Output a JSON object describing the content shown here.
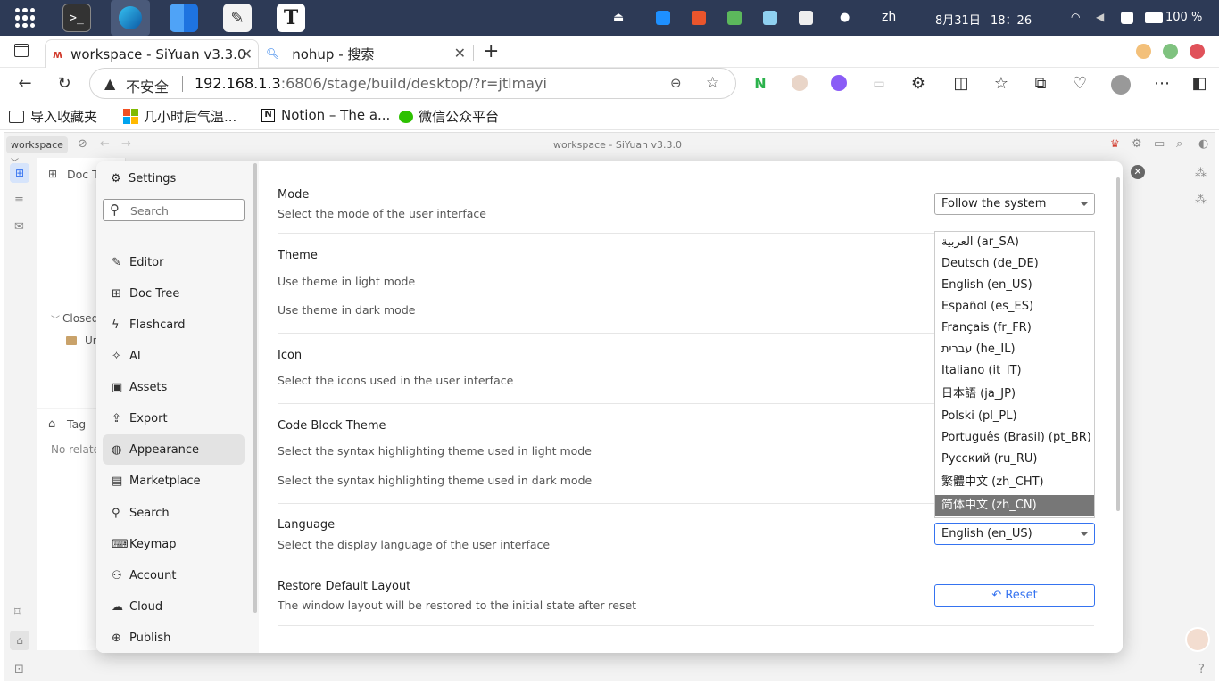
{
  "system": {
    "lang": "zh",
    "date": "8月31日",
    "time": "18：26",
    "battery": "100 %"
  },
  "tabs": [
    {
      "label": "workspace - SiYuan v3.3.0"
    },
    {
      "label": "nohup - 搜索"
    }
  ],
  "address": {
    "security": "不安全",
    "url_host": "192.168.1.3",
    "url_rest": ":6806/stage/build/desktop/?r=jtlmayi"
  },
  "bookmarks": [
    {
      "label": "导入收藏夹"
    },
    {
      "label": "几小时后气温..."
    },
    {
      "label": "Notion – The a..."
    },
    {
      "label": "微信公众平台"
    }
  ],
  "app": {
    "workspace_label": "workspace",
    "title": "workspace - SiYuan v3.3.0",
    "doc_tree_label": "Doc T",
    "closed_label": "Closed",
    "closed_item": "Ur",
    "tag_label": "Tag",
    "no_related": "No relate"
  },
  "settings": {
    "header": "Settings",
    "search_placeholder": "Search",
    "nav": [
      {
        "label": "Editor",
        "icon": "pencil-icon"
      },
      {
        "label": "Doc Tree",
        "icon": "tree-icon"
      },
      {
        "label": "Flashcard",
        "icon": "bolt-icon"
      },
      {
        "label": "AI",
        "icon": "sparkle-icon"
      },
      {
        "label": "Assets",
        "icon": "image-icon"
      },
      {
        "label": "Export",
        "icon": "export-icon"
      },
      {
        "label": "Appearance",
        "icon": "palette-icon"
      },
      {
        "label": "Marketplace",
        "icon": "store-icon"
      },
      {
        "label": "Search",
        "icon": "search-icon"
      },
      {
        "label": "Keymap",
        "icon": "keyboard-icon"
      },
      {
        "label": "Account",
        "icon": "user-icon"
      },
      {
        "label": "Cloud",
        "icon": "cloud-icon"
      },
      {
        "label": "Publish",
        "icon": "globe-icon"
      }
    ],
    "active_nav": "Appearance",
    "sections": {
      "mode_title": "Mode",
      "mode_desc": "Select the mode of the user interface",
      "mode_value": "Follow the system",
      "theme_title": "Theme",
      "theme_light": "Use theme in light mode",
      "theme_dark": "Use theme in dark mode",
      "icon_title": "Icon",
      "icon_desc": "Select the icons used in the user interface",
      "code_title": "Code Block Theme",
      "code_light": "Select the syntax highlighting theme used in light mode",
      "code_dark": "Select the syntax highlighting theme used in dark mode",
      "lang_title": "Language",
      "lang_desc": "Select the display language of the user interface",
      "lang_value": "English (en_US)",
      "restore_title": "Restore Default Layout",
      "restore_desc": "The window layout will be restored to the initial state after reset",
      "reset_label": "Reset"
    },
    "language_options": [
      "العربية (ar_SA)",
      "Deutsch (de_DE)",
      "English (en_US)",
      "Español (es_ES)",
      "Français (fr_FR)",
      "עברית (he_IL)",
      "Italiano (it_IT)",
      "日本語 (ja_JP)",
      "Polski (pl_PL)",
      "Português (Brasil) (pt_BR)",
      "Русский (ru_RU)",
      "繁體中文 (zh_CHT)",
      "简体中文 (zh_CN)"
    ],
    "highlighted_option": "简体中文 (zh_CN)"
  }
}
